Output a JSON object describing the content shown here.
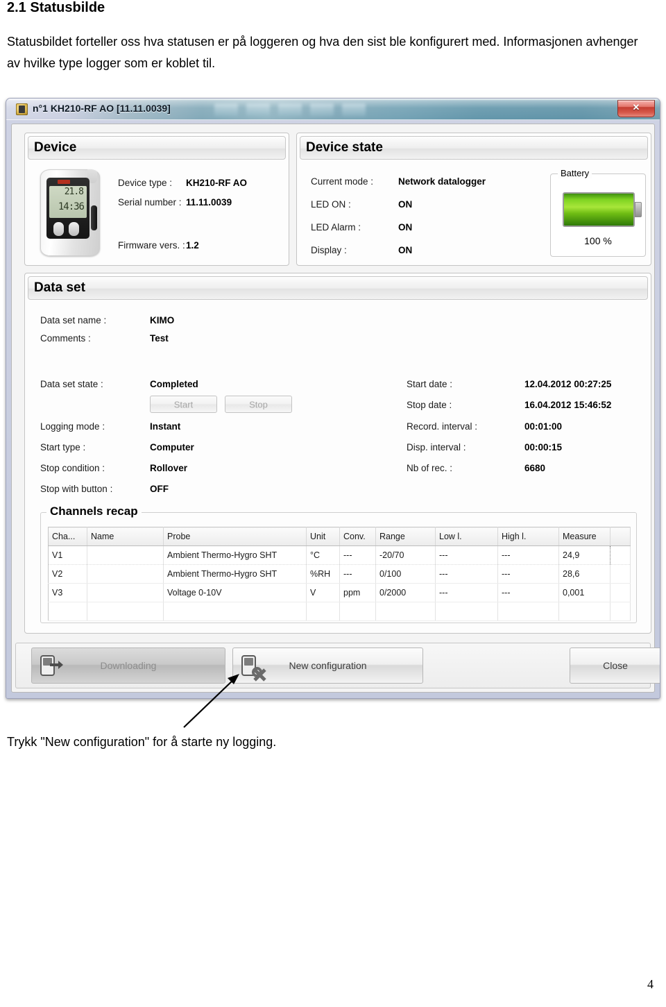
{
  "document": {
    "heading": "2.1 Statusbilde",
    "paragraph": "Statusbildet forteller oss hva statusen er på loggeren og hva den sist ble konfigurert med. Informasjonen avhenger av hvilke type logger som er koblet til.",
    "caption": "Trykk \"New configuration\" for å starte ny logging.",
    "page_number": "4"
  },
  "window": {
    "title": "n°1 KH210-RF AO [11.11.0039]",
    "close_label": "✕"
  },
  "device": {
    "group_title": "Device",
    "fields": [
      {
        "label": "Device type :",
        "value": "KH210-RF AO"
      },
      {
        "label": "Serial number :",
        "value": "11.11.0039"
      },
      {
        "label": "Firmware vers. :",
        "value": "1.2"
      }
    ],
    "photo_lcd_line1": "21.8",
    "photo_lcd_line2": "14:36"
  },
  "device_state": {
    "group_title": "Device state",
    "fields": [
      {
        "label": "Current mode :",
        "value": "Network datalogger"
      },
      {
        "label": "LED ON :",
        "value": "ON"
      },
      {
        "label": "LED Alarm :",
        "value": "ON"
      },
      {
        "label": "Display :",
        "value": "ON"
      }
    ],
    "battery": {
      "legend": "Battery",
      "percent_label": "100 %",
      "level": 100,
      "color": "#7ed321"
    }
  },
  "data_set": {
    "group_title": "Data set",
    "left_fields": [
      {
        "label": "Data set name :",
        "value": "KIMO"
      },
      {
        "label": "Comments :",
        "value": "Test"
      },
      {
        "label": "Data set state :",
        "value": "Completed"
      },
      {
        "label": "Logging mode :",
        "value": "Instant"
      },
      {
        "label": "Start type :",
        "value": "Computer"
      },
      {
        "label": "Stop condition :",
        "value": "Rollover"
      },
      {
        "label": "Stop with button :",
        "value": "OFF"
      }
    ],
    "right_fields": [
      {
        "label": "Start date :",
        "value": "12.04.2012 00:27:25"
      },
      {
        "label": "Stop date :",
        "value": "16.04.2012 15:46:52"
      },
      {
        "label": "Record. interval :",
        "value": "00:01:00"
      },
      {
        "label": "Disp. interval :",
        "value": "00:00:15"
      },
      {
        "label": "Nb of rec. :",
        "value": "6680"
      }
    ],
    "start_button": "Start",
    "stop_button": "Stop"
  },
  "channels_recap": {
    "legend": "Channels recap",
    "columns": [
      "Cha...",
      "Name",
      "Probe",
      "Unit",
      "Conv.",
      "Range",
      "Low l.",
      "High l.",
      "Measure",
      ""
    ],
    "rows": [
      {
        "channel": "V1",
        "name": "",
        "probe": "Ambient Thermo-Hygro SHT",
        "unit": "°C",
        "conv": "---",
        "range": "-20/70",
        "low": "---",
        "high": "---",
        "measure": "24,9"
      },
      {
        "channel": "V2",
        "name": "",
        "probe": "Ambient Thermo-Hygro SHT",
        "unit": "%RH",
        "conv": "---",
        "range": "0/100",
        "low": "---",
        "high": "---",
        "measure": "28,6"
      },
      {
        "channel": "V3",
        "name": "",
        "probe": "Voltage 0-10V",
        "unit": "V",
        "conv": "ppm",
        "range": "0/2000",
        "low": "---",
        "high": "---",
        "measure": "0,001"
      }
    ]
  },
  "toolbar": {
    "downloading_label": "Downloading",
    "new_configuration_label": "New configuration",
    "close_label": "Close"
  }
}
